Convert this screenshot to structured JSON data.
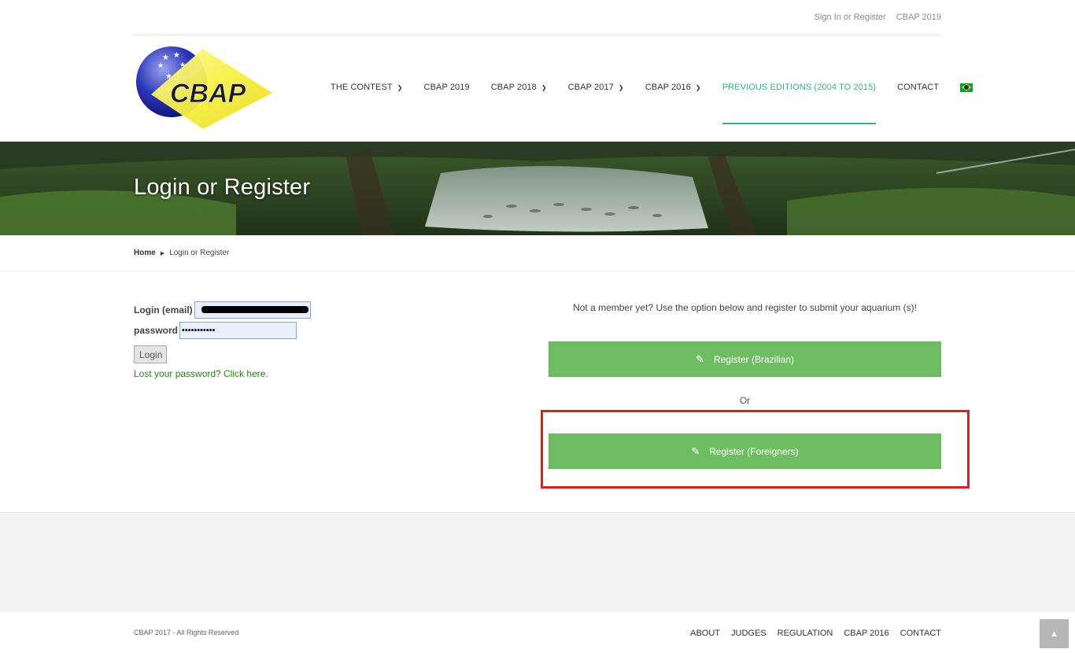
{
  "topbar": {
    "links": [
      "Sign In or Register",
      "CBAP 2019"
    ]
  },
  "logo": {
    "text": "CBAP"
  },
  "nav": {
    "items": [
      {
        "label": "THE CONTEST",
        "has_dropdown": true
      },
      {
        "label": "CBAP 2019",
        "has_dropdown": false
      },
      {
        "label": "CBAP 2018",
        "has_dropdown": true
      },
      {
        "label": "CBAP 2017",
        "has_dropdown": true
      },
      {
        "label": "CBAP 2016",
        "has_dropdown": true
      },
      {
        "label": "PREVIOUS EDITIONS (2004 TO 2015)",
        "has_dropdown": false,
        "active": true
      },
      {
        "label": "CONTACT",
        "has_dropdown": false
      }
    ],
    "language_icon": "brazil-flag-icon"
  },
  "banner": {
    "title": "Login or Register"
  },
  "breadcrumb": {
    "home": "Home",
    "current": "Login or Register"
  },
  "login": {
    "email_label": "Login (email)",
    "password_label": "password",
    "password_value": "•••••••••••",
    "button_label": "Login",
    "lost_password": "Lost your password? Click here."
  },
  "register": {
    "intro": "Not a member yet? Use the option below and register to submit your aquarium (s)!",
    "brazilian_label": "Register (Brazilian)",
    "or_text": "Or",
    "foreigners_label": "Register (Foreigners)",
    "icon": "pencil-icon"
  },
  "footer": {
    "copyright": "CBAP 2017 - All Rights Reserved",
    "links": [
      "ABOUT",
      "JUDGES",
      "REGULATION",
      "CBAP 2016",
      "CONTACT"
    ]
  },
  "colors": {
    "accent": "#2fb58a",
    "register_button": "#6fbd63",
    "highlight": "#d61f26",
    "link_green": "#2a7e1b"
  }
}
